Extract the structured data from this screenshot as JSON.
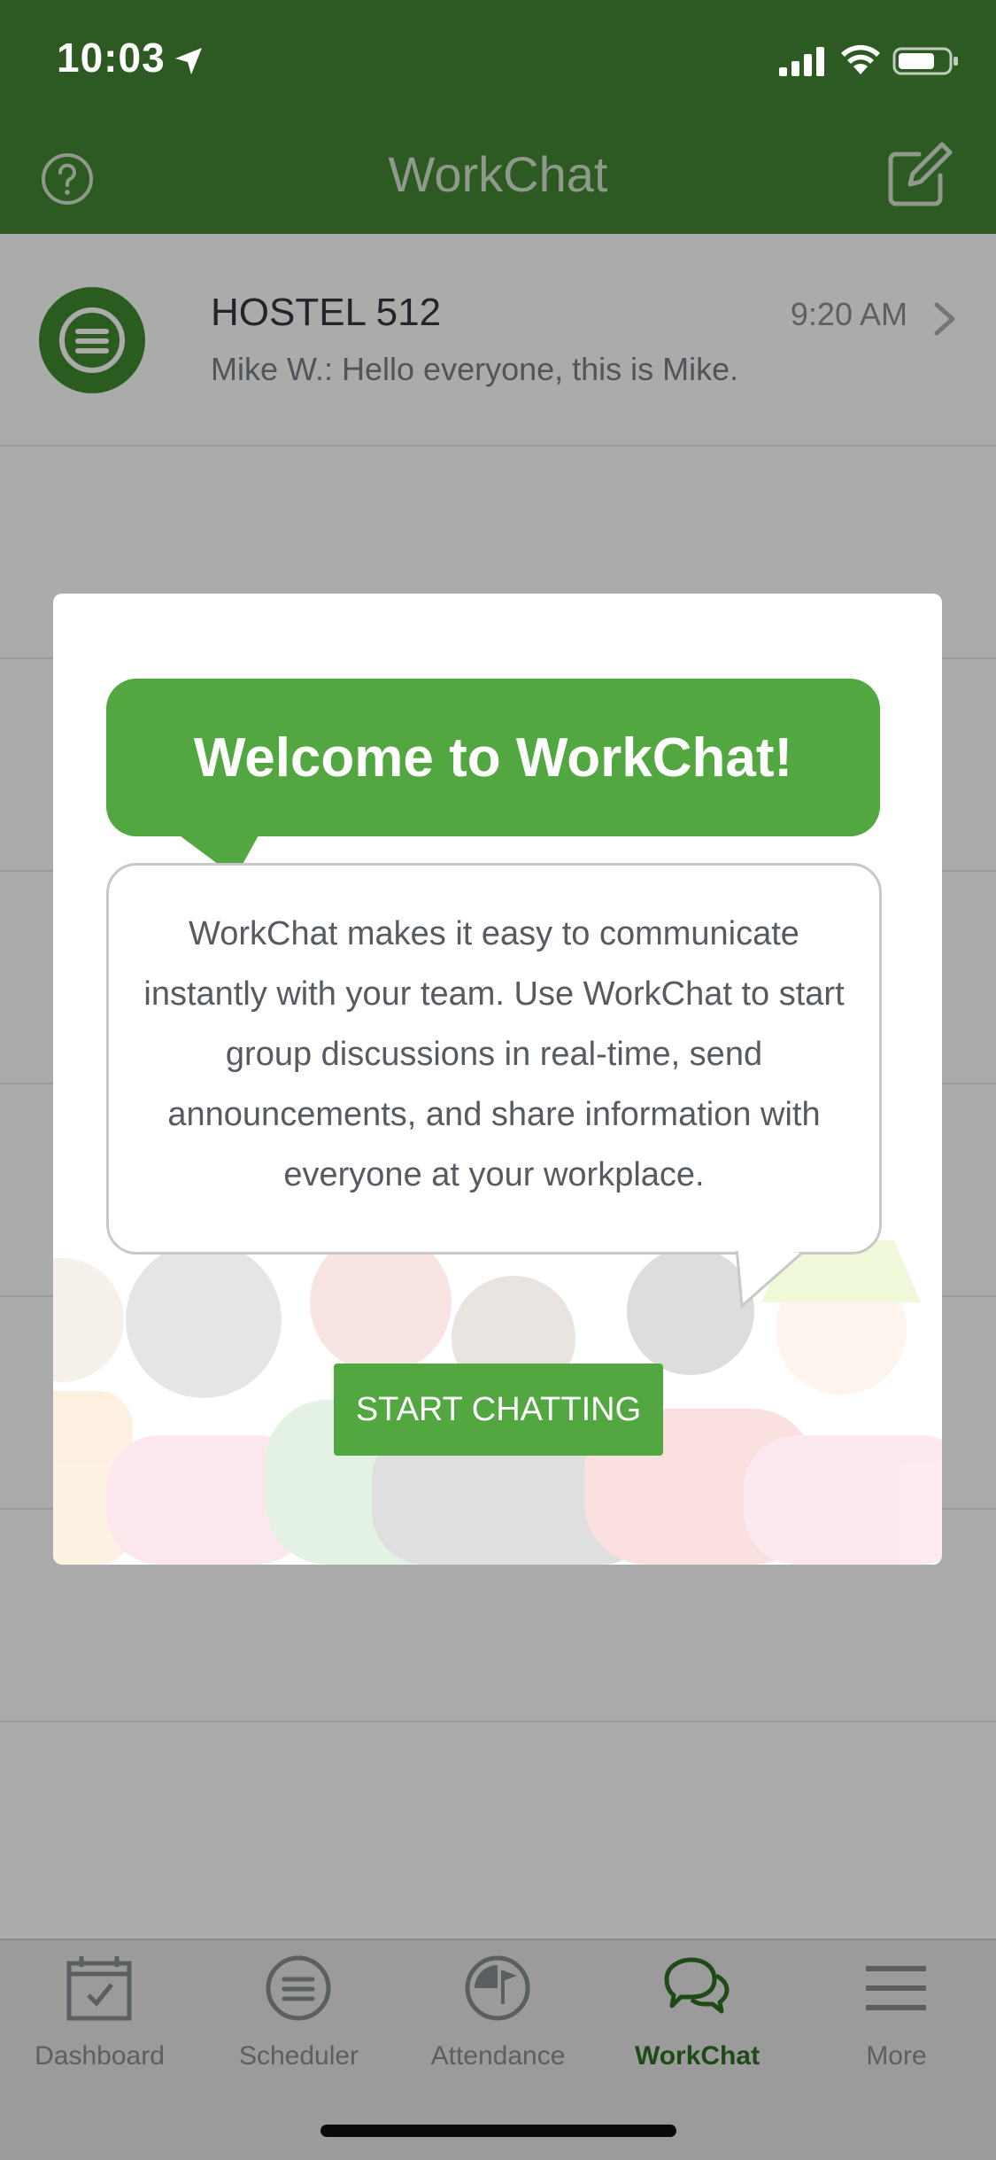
{
  "status_bar": {
    "time": "10:03"
  },
  "nav": {
    "title": "WorkChat"
  },
  "chats": [
    {
      "name": "HOSTEL 512",
      "time": "9:20 AM",
      "preview": "Mike W.: Hello everyone, this is Mike."
    }
  ],
  "modal": {
    "title": "Welcome to WorkChat!",
    "body": "WorkChat makes it easy to communicate instantly with your team. Use WorkChat to start group discussions in real-time, send announcements, and share information with everyone at your workplace.",
    "button_label": "START CHATTING"
  },
  "tabs": [
    {
      "label": "Dashboard",
      "icon": "calendar-check-icon",
      "active": false
    },
    {
      "label": "Scheduler",
      "icon": "scheduler-icon",
      "active": false
    },
    {
      "label": "Attendance",
      "icon": "clock-flag-icon",
      "active": false
    },
    {
      "label": "WorkChat",
      "icon": "chat-bubbles-icon",
      "active": true
    },
    {
      "label": "More",
      "icon": "menu-icon",
      "active": false
    }
  ],
  "colors": {
    "brand_dark_green": "#2c5a22",
    "accent_green": "#53a740",
    "overlay": "rgba(0,0,0,0.33)"
  }
}
